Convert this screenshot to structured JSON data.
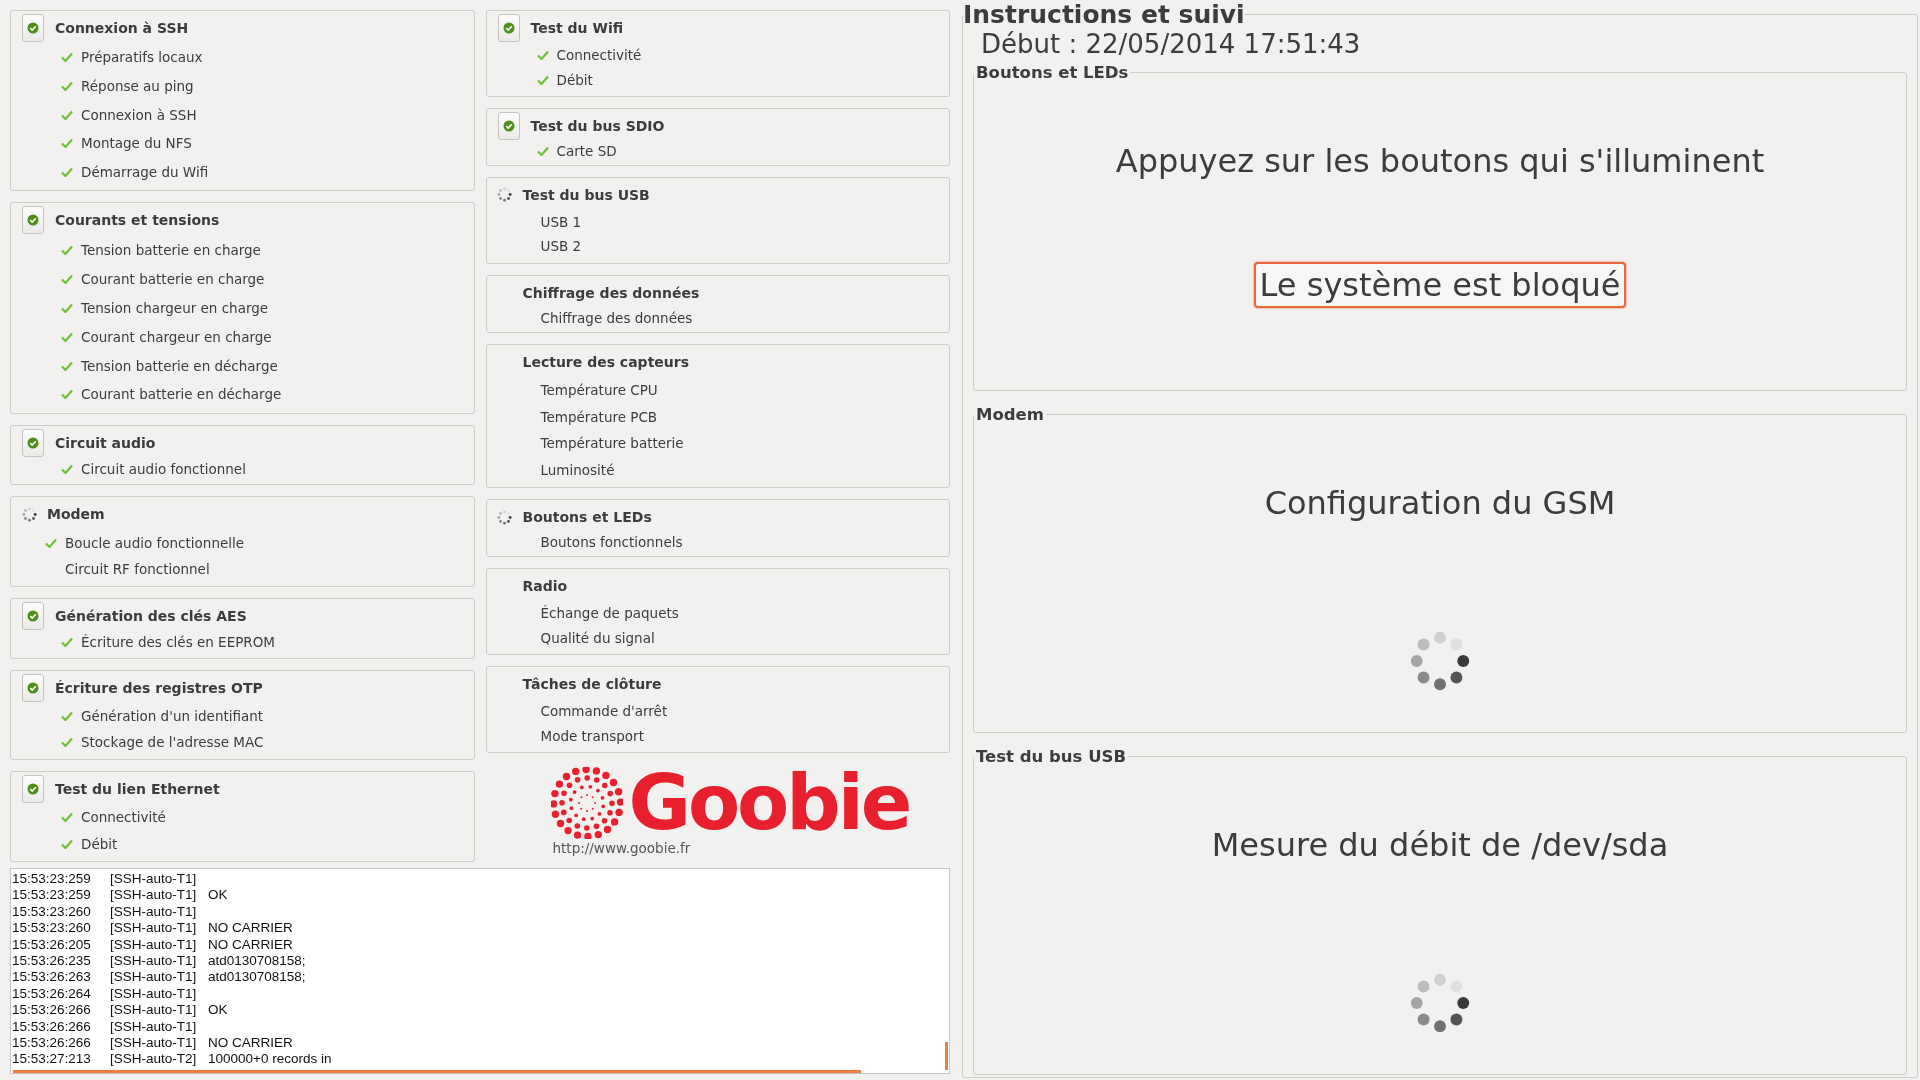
{
  "left_column": [
    {
      "title": "Connexion à SSH",
      "kind": "done",
      "items": [
        {
          "label": "Préparatifs locaux",
          "checked": true
        },
        {
          "label": "Réponse au ping",
          "checked": true
        },
        {
          "label": "Connexion à SSH",
          "checked": true
        },
        {
          "label": "Montage du NFS",
          "checked": true
        },
        {
          "label": "Démarrage du Wifi",
          "checked": true
        }
      ]
    },
    {
      "title": "Courants et tensions",
      "kind": "done",
      "items": [
        {
          "label": "Tension batterie en charge",
          "checked": true
        },
        {
          "label": "Courant batterie en charge",
          "checked": true
        },
        {
          "label": "Tension chargeur en charge",
          "checked": true
        },
        {
          "label": "Courant chargeur en charge",
          "checked": true
        },
        {
          "label": "Tension batterie en décharge",
          "checked": true
        },
        {
          "label": "Courant batterie en décharge",
          "checked": true
        }
      ]
    },
    {
      "title": "Circuit audio",
      "kind": "done",
      "items": [
        {
          "label": "Circuit audio fonctionnel",
          "checked": true
        }
      ]
    },
    {
      "title": "Modem",
      "kind": "running",
      "items": [
        {
          "label": "Boucle audio fonctionnelle",
          "checked": true
        },
        {
          "label": "Circuit RF fonctionnel",
          "checked": false
        }
      ]
    },
    {
      "title": "Génération des clés AES",
      "kind": "done",
      "items": [
        {
          "label": "Écriture des clés en EEPROM",
          "checked": true
        }
      ]
    },
    {
      "title": "Écriture des registres OTP",
      "kind": "done",
      "items": [
        {
          "label": "Génération d'un identifiant",
          "checked": true
        },
        {
          "label": "Stockage de l'adresse MAC",
          "checked": true
        }
      ]
    },
    {
      "title": "Test du lien Ethernet",
      "kind": "done",
      "items": [
        {
          "label": "Connectivité",
          "checked": true
        },
        {
          "label": "Débit",
          "checked": true
        }
      ]
    }
  ],
  "middle_column": [
    {
      "title": "Test du Wifi",
      "kind": "done",
      "items": [
        {
          "label": "Connectivité",
          "checked": true
        },
        {
          "label": "Débit",
          "checked": true
        }
      ]
    },
    {
      "title": "Test du bus SDIO",
      "kind": "done",
      "items": [
        {
          "label": "Carte SD",
          "checked": true
        }
      ]
    },
    {
      "title": "Test du bus USB",
      "kind": "running",
      "items": [
        {
          "label": "USB 1",
          "checked": false
        },
        {
          "label": "USB 2",
          "checked": false
        }
      ]
    },
    {
      "title": "Chiffrage des données",
      "kind": "pending",
      "items": [
        {
          "label": "Chiffrage des données",
          "checked": false
        }
      ]
    },
    {
      "title": "Lecture des capteurs",
      "kind": "pending",
      "items": [
        {
          "label": "Température CPU",
          "checked": false
        },
        {
          "label": "Température PCB",
          "checked": false
        },
        {
          "label": "Température batterie",
          "checked": false
        },
        {
          "label": "Luminosité",
          "checked": false
        }
      ]
    },
    {
      "title": "Boutons et LEDs",
      "kind": "running",
      "items": [
        {
          "label": "Boutons fonctionnels",
          "checked": false
        }
      ]
    },
    {
      "title": "Radio",
      "kind": "pending",
      "items": [
        {
          "label": "Échange de paquets",
          "checked": false
        },
        {
          "label": "Qualité du signal",
          "checked": false
        }
      ]
    },
    {
      "title": "Tâches de clôture",
      "kind": "pending",
      "items": [
        {
          "label": "Commande d'arrêt",
          "checked": false
        },
        {
          "label": "Mode transport",
          "checked": false
        }
      ]
    }
  ],
  "logo": {
    "name": "Goobie",
    "url": "http://www.goobie.fr"
  },
  "log": [
    {
      "time": "15:53:23:259",
      "thread": "[SSH-auto-T1]"
    },
    {
      "time": "15:53:23:259",
      "thread": "[SSH-auto-T1]",
      "message": "OK"
    },
    {
      "time": "15:53:23:260",
      "thread": "[SSH-auto-T1]"
    },
    {
      "time": "15:53:23:260",
      "thread": "[SSH-auto-T1]",
      "message": "NO CARRIER"
    },
    {
      "time": "15:53:26:205",
      "thread": "[SSH-auto-T1]",
      "message": "NO CARRIER"
    },
    {
      "time": "15:53:26:235",
      "thread": "[SSH-auto-T1]",
      "message": "atd0130708158;"
    },
    {
      "time": "15:53:26:263",
      "thread": "[SSH-auto-T1]",
      "message": "atd0130708158;"
    },
    {
      "time": "15:53:26:264",
      "thread": "[SSH-auto-T1]"
    },
    {
      "time": "15:53:26:266",
      "thread": "[SSH-auto-T1]",
      "message": "OK"
    },
    {
      "time": "15:53:26:266",
      "thread": "[SSH-auto-T1]"
    },
    {
      "time": "15:53:26:266",
      "thread": "[SSH-auto-T1]",
      "message": "NO CARRIER"
    },
    {
      "time": "15:53:27:213",
      "thread": "[SSH-auto-T2]",
      "message": "100000+0 records in"
    }
  ],
  "panel": {
    "title": "Instructions et suivi",
    "start": "Début : 22/05/2014 17:51:43",
    "sections": [
      {
        "title": "Boutons et LEDs",
        "instruction": "Appuyez sur les boutons qui s'illuminent",
        "alert": "Le système est bloqué",
        "busy": false
      },
      {
        "title": "Modem",
        "instruction": "Configuration du GSM",
        "busy": true
      },
      {
        "title": "Test du bus USB",
        "instruction": "Mesure du débit de /dev/sda",
        "busy": true
      }
    ]
  }
}
